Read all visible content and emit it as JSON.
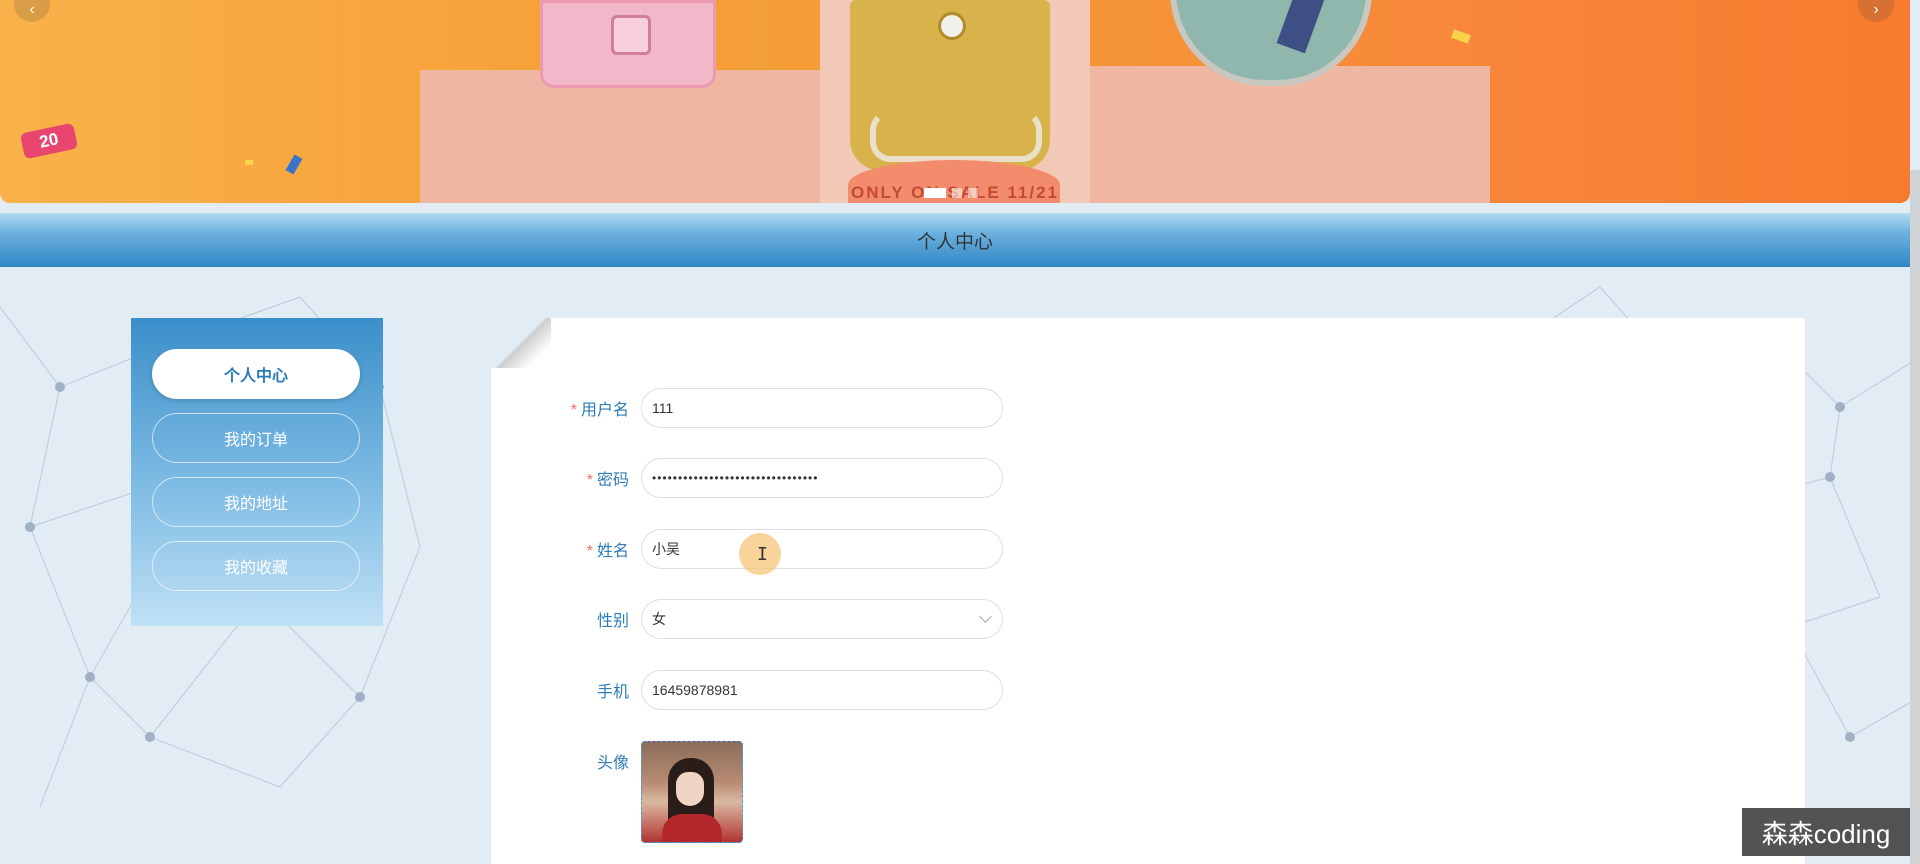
{
  "banner": {
    "badge_text": "20",
    "drum_text": "ONLY ON SALE 11/21",
    "prev_arrow": "‹",
    "next_arrow": "›",
    "slide_count": 3,
    "active_slide": 1
  },
  "header": {
    "title": "个人中心"
  },
  "sidebar": {
    "items": [
      {
        "label": "个人中心",
        "active": true
      },
      {
        "label": "我的订单",
        "active": false
      },
      {
        "label": "我的地址",
        "active": false
      },
      {
        "label": "我的收藏",
        "active": false
      }
    ]
  },
  "form": {
    "username": {
      "label": "用户名",
      "required": "*",
      "value": "111"
    },
    "password": {
      "label": "密码",
      "required": "*",
      "value": "••••••••••••••••••••••••••••••••"
    },
    "name": {
      "label": "姓名",
      "required": "*",
      "value": "小吴"
    },
    "gender": {
      "label": "性别",
      "value": "女"
    },
    "phone": {
      "label": "手机",
      "value": "16459878981"
    },
    "avatar": {
      "label": "头像"
    }
  },
  "cursor": {
    "glyph": "I"
  },
  "watermark": {
    "text": "森森coding"
  },
  "colors": {
    "accent": "#2f86c6",
    "label": "#2f7cb6",
    "required": "#f56c6c",
    "banner_orange": "#f7a43c"
  }
}
